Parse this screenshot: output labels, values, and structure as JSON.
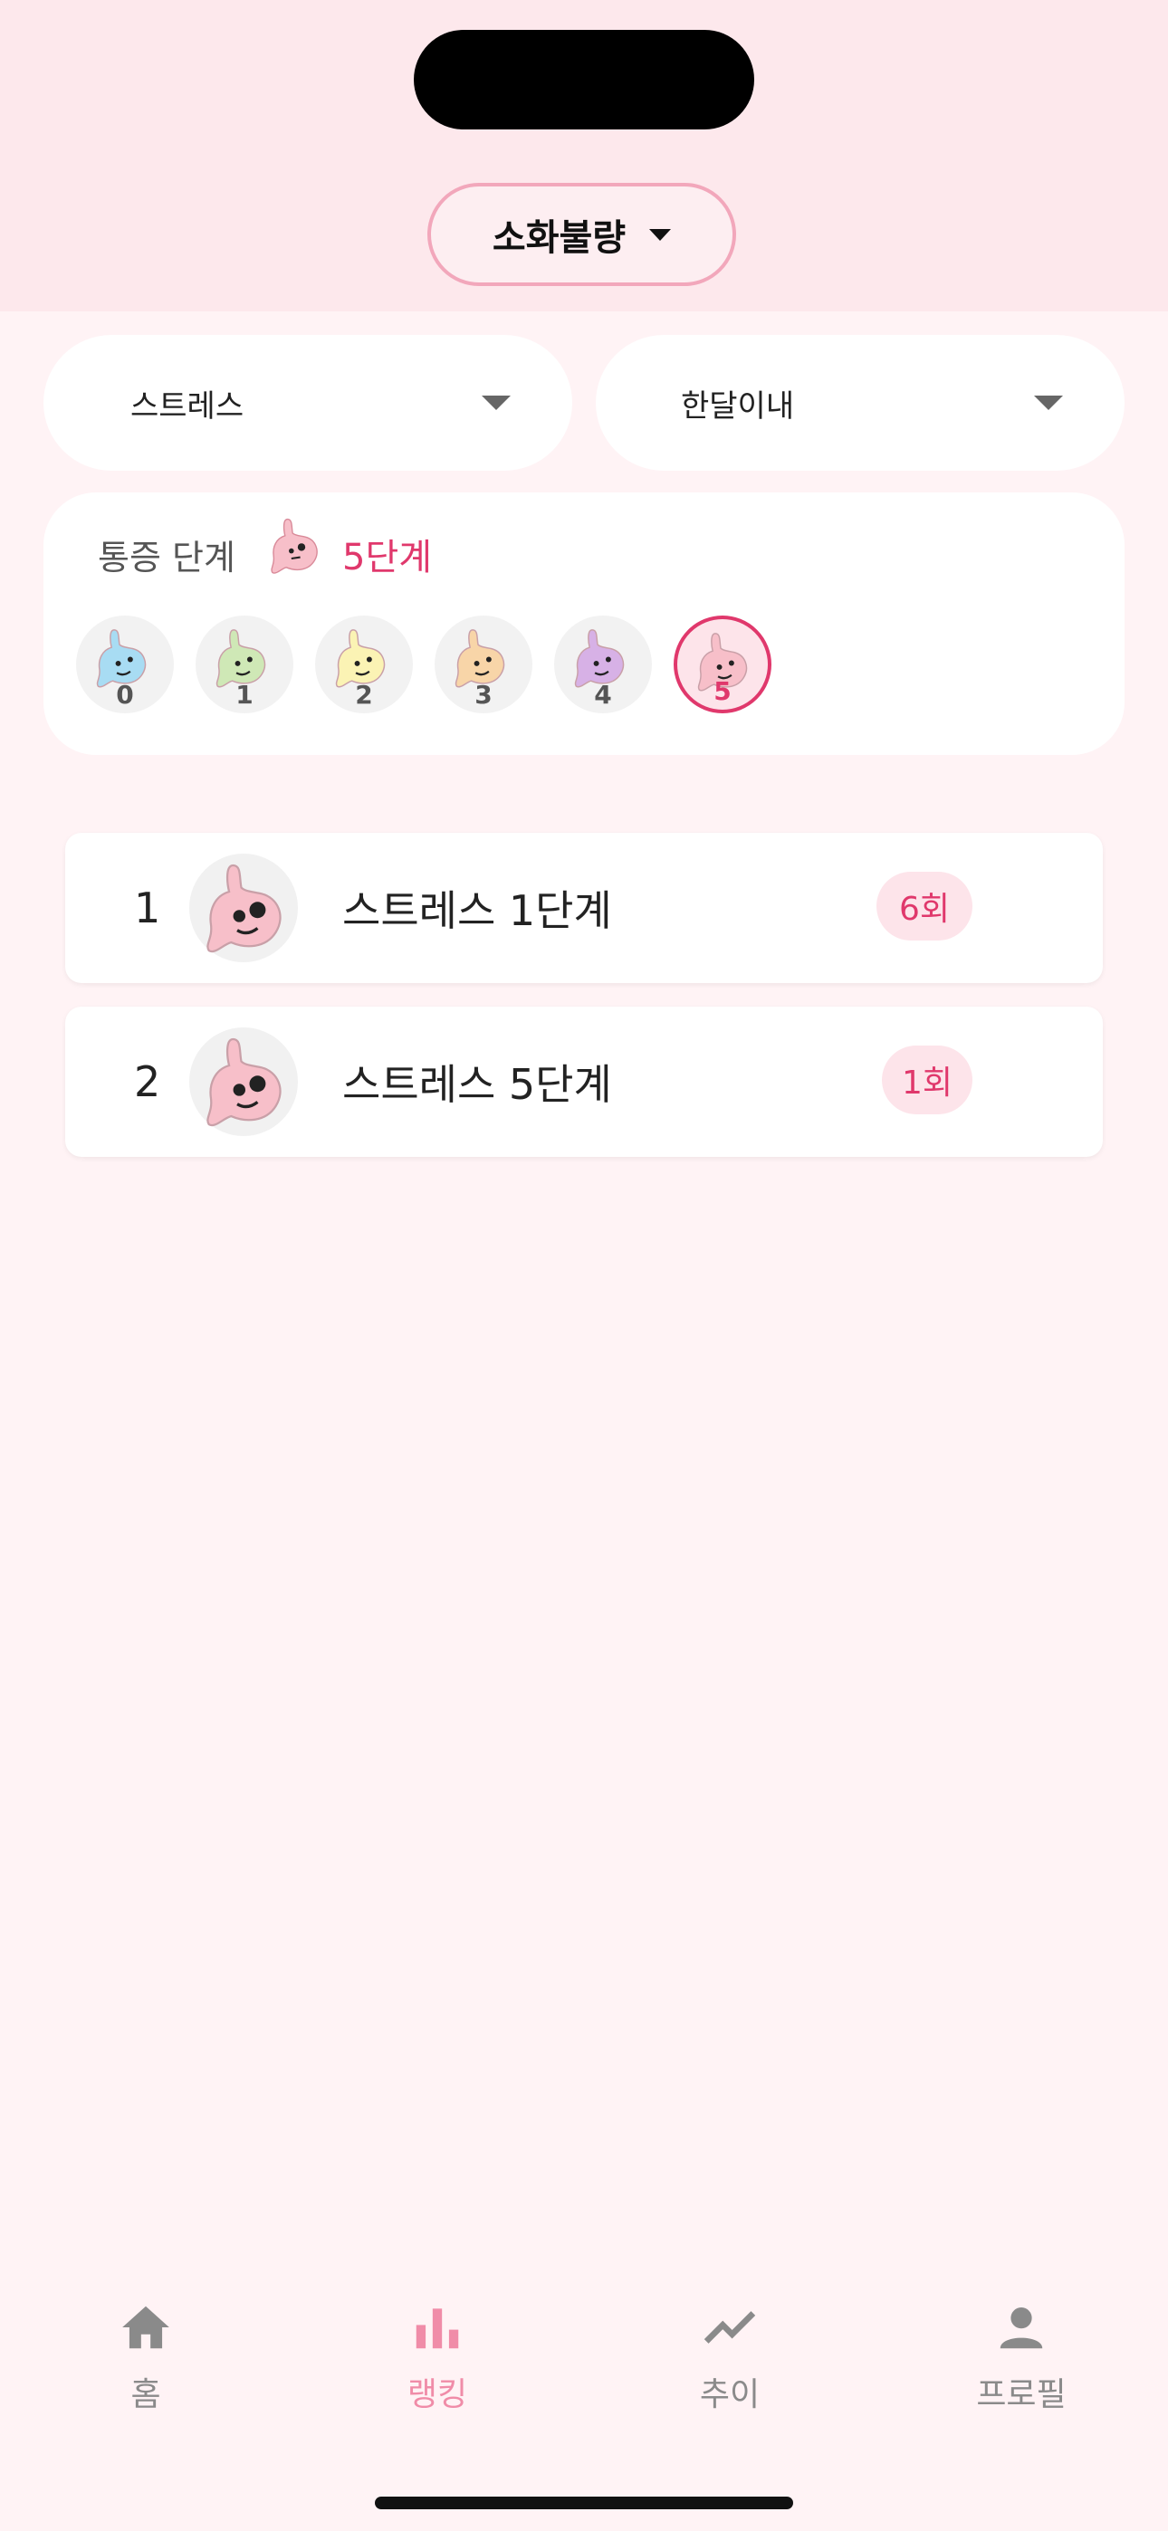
{
  "header": {
    "category_label": "소화불량"
  },
  "filters": {
    "trigger": "스트레스",
    "period": "한달이내"
  },
  "pain": {
    "title": "통증 단계",
    "value": "5단계",
    "selected_level": 5,
    "levels": [
      {
        "num": "0",
        "color": "#a8dcf3"
      },
      {
        "num": "1",
        "color": "#cfe8b6"
      },
      {
        "num": "2",
        "color": "#fbf3b4"
      },
      {
        "num": "3",
        "color": "#f8d5a8"
      },
      {
        "num": "4",
        "color": "#d7b1e6"
      },
      {
        "num": "5",
        "color": "#f7bfc9"
      }
    ]
  },
  "ranking": [
    {
      "rank": "1",
      "label": "스트레스 1단계",
      "count": "6회"
    },
    {
      "rank": "2",
      "label": "스트레스 5단계",
      "count": "1회"
    }
  ],
  "tabs": [
    {
      "label": "홈",
      "icon": "home-icon"
    },
    {
      "label": "랭킹",
      "icon": "bar-chart-icon",
      "active": true
    },
    {
      "label": "추이",
      "icon": "trend-icon"
    },
    {
      "label": "프로필",
      "icon": "person-icon"
    }
  ],
  "colors": {
    "accent": "#e0386c",
    "tab_active": "#f08ca8",
    "background": "#fff3f5",
    "header_bg": "#fde8ec"
  }
}
